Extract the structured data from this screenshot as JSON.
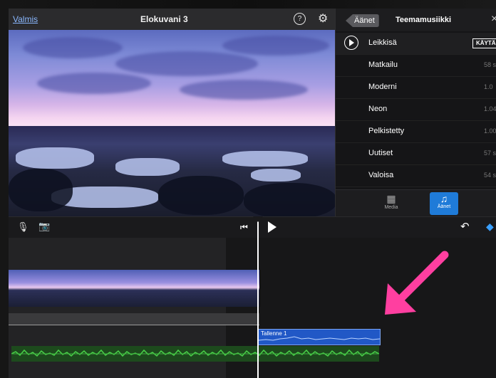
{
  "topbar": {
    "done_label": "Valmis",
    "title": "Elokuvani 3"
  },
  "panel": {
    "back_label": "Äänet",
    "title": "Teemamusiikki",
    "use_label": "KÄYTÄ",
    "items": [
      {
        "label": "Leikkisä",
        "duration": ""
      },
      {
        "label": "Matkailu",
        "duration": "58 s"
      },
      {
        "label": "Moderni",
        "duration": "1.0"
      },
      {
        "label": "Neon",
        "duration": "1.04"
      },
      {
        "label": "Pelkistetty",
        "duration": "1.00"
      },
      {
        "label": "Uutiset",
        "duration": "57 s"
      },
      {
        "label": "Valoisa",
        "duration": "54 s"
      }
    ],
    "tabs": [
      {
        "label": "Media"
      },
      {
        "label": "Äänet"
      }
    ]
  },
  "timeline": {
    "recording_label": "Tallenne 1"
  },
  "colors": {
    "accent": "#1f7bd8",
    "arrow": "#ff3fa0",
    "audio_green": "#3fb03f",
    "recording_blue": "#2158c6"
  }
}
